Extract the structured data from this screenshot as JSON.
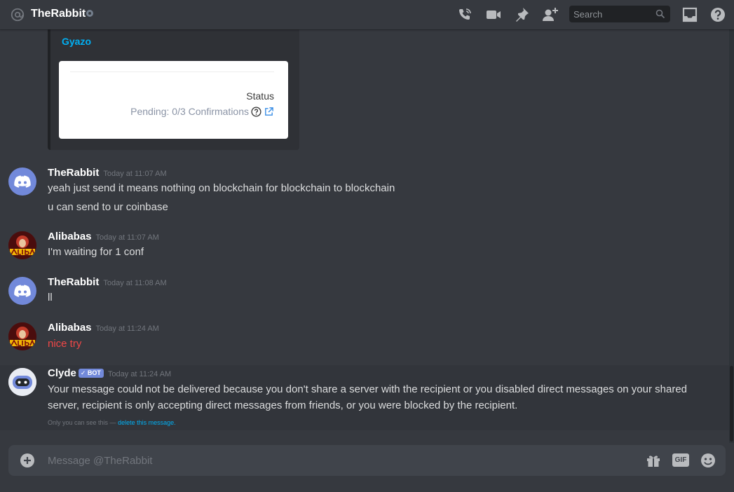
{
  "header": {
    "channel_name": "TheRabbit",
    "search_placeholder": "Search",
    "icons": [
      "at-icon",
      "status-offline-icon",
      "voice-call-icon",
      "video-call-icon",
      "pin-icon",
      "add-friend-icon",
      "search-icon",
      "inbox-icon",
      "help-icon"
    ]
  },
  "embed": {
    "provider": "Gyazo",
    "status_label": "Status",
    "status_value": "Pending: 0/3 Confirmations"
  },
  "messages": [
    {
      "author": "TheRabbit",
      "timestamp": "Today at 11:07 AM",
      "lines": [
        "yeah just send it means nothing on blockchain for blockchain to blockchain",
        "u can send to ur coinbase"
      ]
    },
    {
      "author": "Alibabas",
      "timestamp": "Today at 11:07 AM",
      "lines": [
        "I'm waiting for 1 conf"
      ]
    },
    {
      "author": "TheRabbit",
      "timestamp": "Today at 11:08 AM",
      "lines": [
        "ll"
      ]
    },
    {
      "author": "Alibabas",
      "timestamp": "Today at 11:24 AM",
      "lines": [
        "nice try"
      ],
      "color": "#f04747"
    },
    {
      "author": "Clyde",
      "bot_tag": "BOT",
      "timestamp": "Today at 11:24 AM",
      "lines": [
        "Your message could not be delivered because you don't share a server with the recipient or you disabled direct messages on your shared server, recipient is only accepting direct messages from friends, or you were blocked by the recipient."
      ],
      "ephemeral_note": "Only you can see this —",
      "ephemeral_link": "delete this message."
    }
  ],
  "composer": {
    "placeholder": "Message @TheRabbit",
    "buttons": [
      "gift-icon",
      "GIF",
      "emoji-icon"
    ],
    "gif_label": "GIF"
  },
  "colors": {
    "background": "#36393f",
    "blurple": "#7289da",
    "link": "#00b0f4",
    "error": "#f04747"
  }
}
